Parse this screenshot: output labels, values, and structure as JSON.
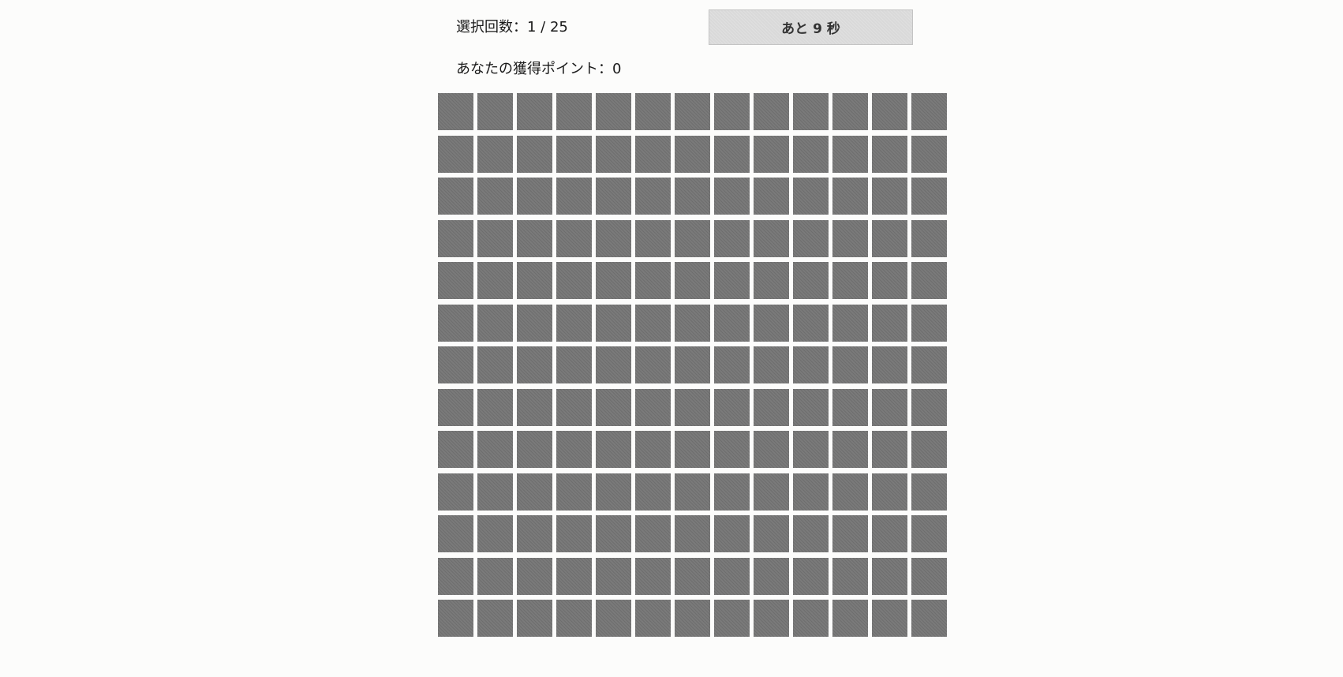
{
  "status": {
    "select_count": "選択回数：1 / 25",
    "timer": "あと 9 秒",
    "points": "あなたの獲得ポイント：0"
  },
  "board": {
    "rows": 13,
    "columns": 13,
    "tile_color": "#7a7a7a"
  }
}
